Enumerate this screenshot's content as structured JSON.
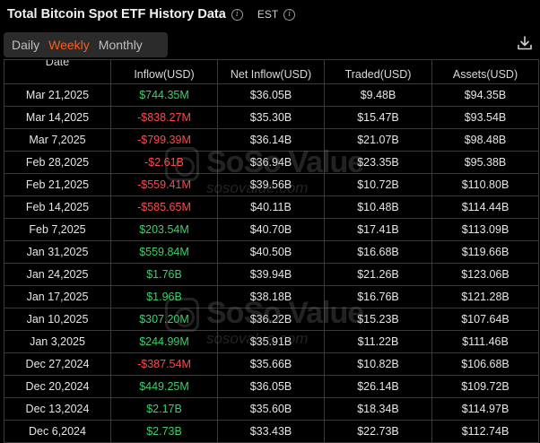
{
  "header": {
    "title": "Total Bitcoin Spot ETF History Data",
    "timezone": "EST"
  },
  "tabs": [
    {
      "label": "Daily",
      "active": false
    },
    {
      "label": "Weekly",
      "active": true
    },
    {
      "label": "Monthly",
      "active": false
    }
  ],
  "watermark": {
    "brand": "SoSo Value",
    "domain": "sosovalue.com"
  },
  "colors": {
    "accent": "#ff5a1f",
    "positive": "#3ecf6b",
    "negative": "#ff4a4a"
  },
  "table": {
    "columns": [
      "Date",
      "Inflow(USD)",
      "Net Inflow(USD)",
      "Traded(USD)",
      "Assets(USD)"
    ],
    "rows": [
      {
        "date": "Mar 21,2025",
        "inflow": "$744.35M",
        "sign": "pos",
        "net": "$36.05B",
        "traded": "$9.48B",
        "assets": "$94.35B"
      },
      {
        "date": "Mar 14,2025",
        "inflow": "-$838.27M",
        "sign": "neg",
        "net": "$35.30B",
        "traded": "$15.47B",
        "assets": "$93.54B"
      },
      {
        "date": "Mar 7,2025",
        "inflow": "-$799.39M",
        "sign": "neg",
        "net": "$36.14B",
        "traded": "$21.07B",
        "assets": "$98.48B"
      },
      {
        "date": "Feb 28,2025",
        "inflow": "-$2.61B",
        "sign": "neg",
        "net": "$36.94B",
        "traded": "$23.35B",
        "assets": "$95.38B"
      },
      {
        "date": "Feb 21,2025",
        "inflow": "-$559.41M",
        "sign": "neg",
        "net": "$39.56B",
        "traded": "$10.72B",
        "assets": "$110.80B"
      },
      {
        "date": "Feb 14,2025",
        "inflow": "-$585.65M",
        "sign": "neg",
        "net": "$40.11B",
        "traded": "$10.48B",
        "assets": "$114.44B"
      },
      {
        "date": "Feb 7,2025",
        "inflow": "$203.54M",
        "sign": "pos",
        "net": "$40.70B",
        "traded": "$17.41B",
        "assets": "$113.09B"
      },
      {
        "date": "Jan 31,2025",
        "inflow": "$559.84M",
        "sign": "pos",
        "net": "$40.50B",
        "traded": "$16.68B",
        "assets": "$119.66B"
      },
      {
        "date": "Jan 24,2025",
        "inflow": "$1.76B",
        "sign": "pos",
        "net": "$39.94B",
        "traded": "$21.26B",
        "assets": "$123.06B"
      },
      {
        "date": "Jan 17,2025",
        "inflow": "$1.96B",
        "sign": "pos",
        "net": "$38.18B",
        "traded": "$16.76B",
        "assets": "$121.28B"
      },
      {
        "date": "Jan 10,2025",
        "inflow": "$307.20M",
        "sign": "pos",
        "net": "$36.22B",
        "traded": "$15.23B",
        "assets": "$107.64B"
      },
      {
        "date": "Jan 3,2025",
        "inflow": "$244.99M",
        "sign": "pos",
        "net": "$35.91B",
        "traded": "$11.22B",
        "assets": "$111.46B"
      },
      {
        "date": "Dec 27,2024",
        "inflow": "-$387.54M",
        "sign": "neg",
        "net": "$35.66B",
        "traded": "$10.82B",
        "assets": "$106.68B"
      },
      {
        "date": "Dec 20,2024",
        "inflow": "$449.25M",
        "sign": "pos",
        "net": "$36.05B",
        "traded": "$26.14B",
        "assets": "$109.72B"
      },
      {
        "date": "Dec 13,2024",
        "inflow": "$2.17B",
        "sign": "pos",
        "net": "$35.60B",
        "traded": "$18.34B",
        "assets": "$114.97B"
      },
      {
        "date": "Dec 6,2024",
        "inflow": "$2.73B",
        "sign": "pos",
        "net": "$33.43B",
        "traded": "$22.73B",
        "assets": "$112.74B"
      }
    ]
  }
}
